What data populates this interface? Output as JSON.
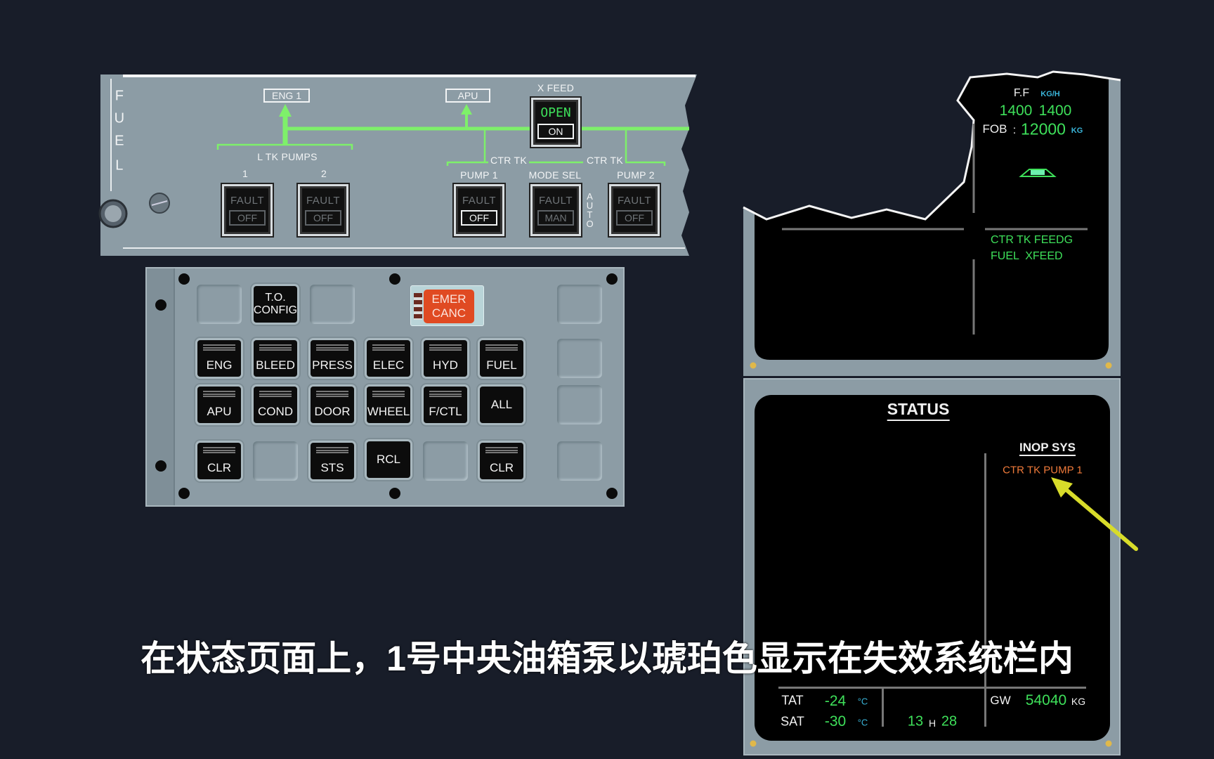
{
  "colors": {
    "background": "#181d29",
    "panel": "#8c9ca5",
    "ecam_green": "#3ee05a",
    "ecam_cyan": "#3ab4d8",
    "ecam_amber": "#f07a3a",
    "arrow": "#d8dc2a",
    "emer_canc": "#e04a22"
  },
  "fuel_panel": {
    "title_letters": [
      "F",
      "U",
      "E",
      "L"
    ],
    "eng1": "ENG 1",
    "apu": "APU",
    "xfeed_label": "X FEED",
    "xfeed_open": "OPEN",
    "xfeed_on": "ON",
    "ltk_pumps": "L TK PUMPS",
    "pump_num_1": "1",
    "pump_num_2": "2",
    "ctr_tk_left": "CTR TK",
    "ctr_tk_right": "CTR TK",
    "pump1": "PUMP 1",
    "mode_sel": "MODE SEL",
    "pump2": "PUMP 2",
    "auto": "AUTO",
    "buttons": [
      {
        "fault": "FAULT",
        "state": "OFF",
        "lit": false
      },
      {
        "fault": "FAULT",
        "state": "OFF",
        "lit": false
      },
      {
        "fault": "FAULT",
        "state": "OFF",
        "lit": true
      },
      {
        "fault": "FAULT",
        "state": "MAN",
        "lit": false
      },
      {
        "fault": "FAULT",
        "state": "OFF",
        "lit": false
      }
    ]
  },
  "ecp": {
    "to_config": [
      "T.O.",
      "CONFIG"
    ],
    "emer_canc": [
      "EMER",
      "CANC"
    ],
    "row2": [
      "ENG",
      "BLEED",
      "PRESS",
      "ELEC",
      "HYD",
      "FUEL"
    ],
    "row3": [
      "APU",
      "COND",
      "DOOR",
      "WHEEL",
      "F/CTL",
      "ALL"
    ],
    "row4": [
      "CLR",
      "STS",
      "RCL",
      "CLR"
    ]
  },
  "upper_ecam": {
    "ff_label": "F.F",
    "ff_unit": "KG/H",
    "ff_left": "1400",
    "ff_right": "1400",
    "fob_label": "FOB",
    "fob_sep": ":",
    "fob_value": "12000",
    "fob_unit": "KG",
    "memo": [
      "CTR TK FEEDG",
      "FUEL  XFEED"
    ]
  },
  "status_ecam": {
    "title": "STATUS",
    "inop_title": "INOP SYS",
    "inop_items": [
      "CTR TK PUMP 1"
    ],
    "tat_label": "TAT",
    "tat_value": "-24",
    "sat_label": "SAT",
    "sat_value": "-30",
    "temp_unit": "°C",
    "time_h": "13",
    "time_sep": "H",
    "time_m": "28",
    "gw_label": "GW",
    "gw_value": "54040",
    "gw_unit": "KG"
  },
  "subtitle": "在状态页面上，1号中央油箱泵以琥珀色显示在失效系统栏内"
}
